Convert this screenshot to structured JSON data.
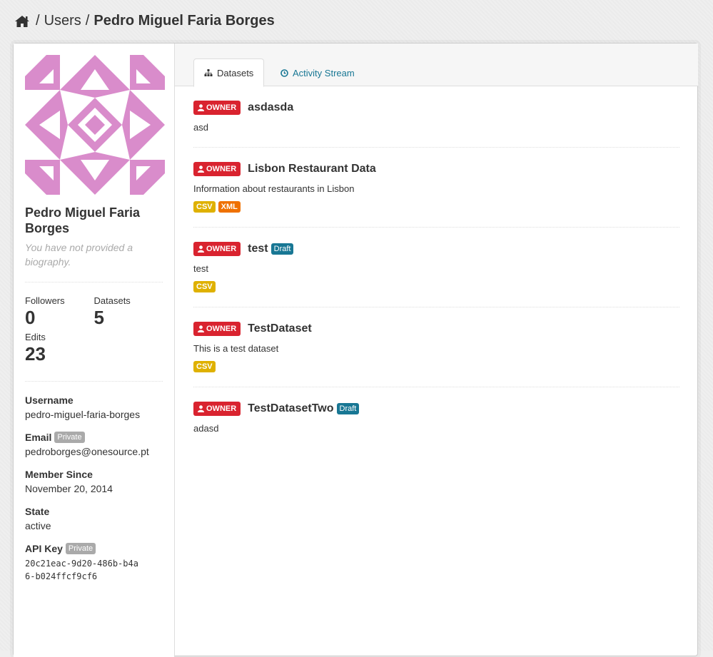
{
  "breadcrumb": {
    "users": "Users",
    "current": "Pedro Miguel Faria Borges"
  },
  "profile": {
    "name": "Pedro Miguel Faria Borges",
    "bio": "You have not provided a biography.",
    "stats": {
      "followers_label": "Followers",
      "followers_value": "0",
      "datasets_label": "Datasets",
      "datasets_value": "5",
      "edits_label": "Edits",
      "edits_value": "23"
    },
    "username_label": "Username",
    "username": "pedro-miguel-faria-borges",
    "email_label": "Email",
    "email_badge": "Private",
    "email": "pedroborges@onesource.pt",
    "member_since_label": "Member Since",
    "member_since": "November 20, 2014",
    "state_label": "State",
    "state": "active",
    "api_key_label": "API Key",
    "api_key_badge": "Private",
    "api_key": "20c21eac-9d20-486b-b4a6-b024ffcf9cf6",
    "avatar_color": "#d98ccb"
  },
  "tabs": {
    "datasets": "Datasets",
    "activity": "Activity Stream"
  },
  "owner_label": "OWNER",
  "draft_label": "Draft",
  "datasets": [
    {
      "title": "asdasda",
      "description": "asd",
      "draft": false,
      "formats": []
    },
    {
      "title": "Lisbon Restaurant Data",
      "description": "Information about restaurants in Lisbon",
      "draft": false,
      "formats": [
        "CSV",
        "XML"
      ]
    },
    {
      "title": "test",
      "description": "test",
      "draft": true,
      "formats": [
        "CSV"
      ]
    },
    {
      "title": "TestDataset",
      "description": "This is a test dataset",
      "draft": false,
      "formats": [
        "CSV"
      ]
    },
    {
      "title": "TestDatasetTwo",
      "description": "adasd",
      "draft": true,
      "formats": []
    }
  ],
  "colors": {
    "owner": "#d9232f",
    "draft": "#187794",
    "csv": "#dfb100",
    "xml": "#ef7100",
    "link": "#187794"
  }
}
